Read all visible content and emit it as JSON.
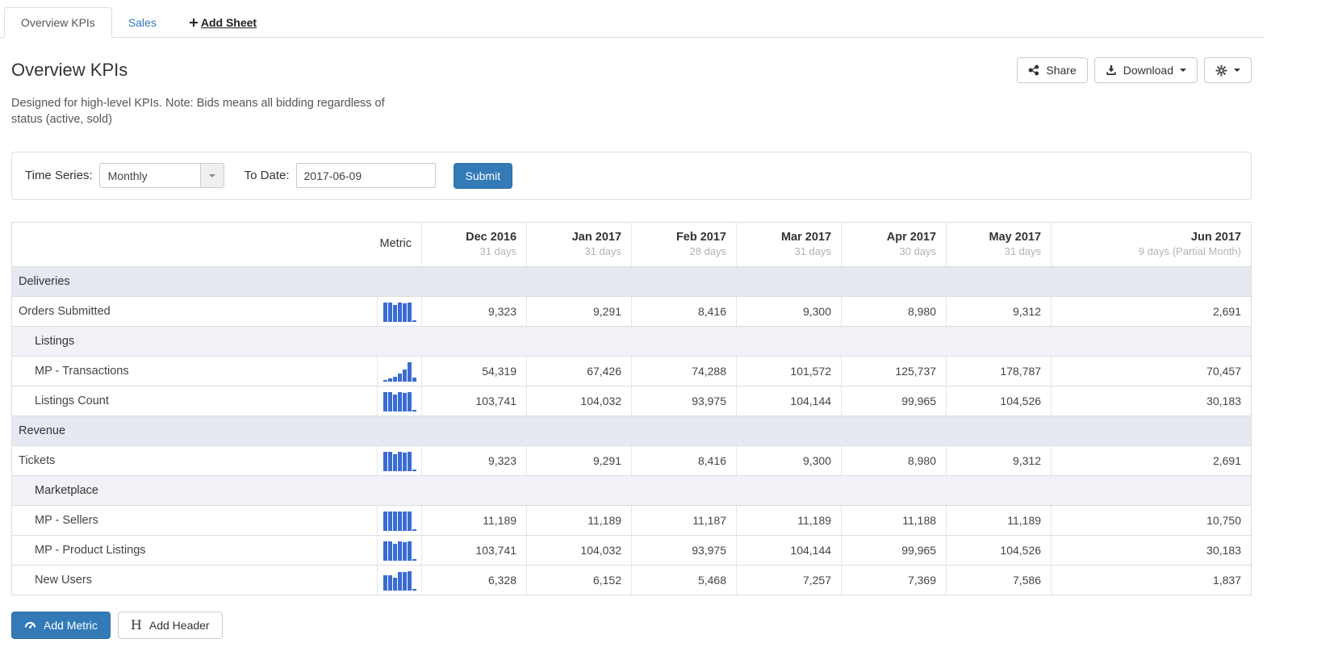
{
  "tabs": [
    {
      "label": "Overview KPIs",
      "active": true
    },
    {
      "label": "Sales",
      "active": false
    },
    {
      "label": "Add Sheet",
      "active": false
    }
  ],
  "header": {
    "title": "Overview KPIs",
    "description": "Designed for high-level KPIs. Note: Bids means all bidding regardless of status (active, sold)",
    "buttons": {
      "share": "Share",
      "download": "Download"
    }
  },
  "filters": {
    "time_series_label": "Time Series:",
    "time_series_value": "Monthly",
    "to_date_label": "To Date:",
    "to_date_value": "2017-06-09",
    "submit_label": "Submit"
  },
  "table": {
    "metric_header": "Metric",
    "columns": [
      {
        "label": "Dec 2016",
        "sub": "31 days"
      },
      {
        "label": "Jan 2017",
        "sub": "31 days"
      },
      {
        "label": "Feb 2017",
        "sub": "28 days"
      },
      {
        "label": "Mar 2017",
        "sub": "31 days"
      },
      {
        "label": "Apr 2017",
        "sub": "30 days"
      },
      {
        "label": "May 2017",
        "sub": "31 days"
      },
      {
        "label": "Jun 2017",
        "sub": "9 days (Partial Month)"
      }
    ],
    "rows": [
      {
        "type": "group",
        "label": "Deliveries",
        "indent": 0
      },
      {
        "type": "metric",
        "label": "Orders Submitted",
        "indent": 0,
        "values": [
          9323,
          9291,
          8416,
          9300,
          8980,
          9312,
          2691
        ]
      },
      {
        "type": "group",
        "label": "Listings",
        "indent": 1
      },
      {
        "type": "metric",
        "label": "MP - Transactions",
        "indent": 1,
        "values": [
          54319,
          67426,
          74288,
          101572,
          125737,
          178787,
          70457
        ]
      },
      {
        "type": "metric",
        "label": "Listings Count",
        "indent": 1,
        "values": [
          103741,
          104032,
          93975,
          104144,
          99965,
          104526,
          30183
        ]
      },
      {
        "type": "group",
        "label": "Revenue",
        "indent": 0
      },
      {
        "type": "metric",
        "label": "Tickets",
        "indent": 0,
        "values": [
          9323,
          9291,
          8416,
          9300,
          8980,
          9312,
          2691
        ]
      },
      {
        "type": "group",
        "label": "Marketplace",
        "indent": 1
      },
      {
        "type": "metric",
        "label": "MP - Sellers",
        "indent": 1,
        "values": [
          11189,
          11189,
          11187,
          11189,
          11188,
          11189,
          10750
        ]
      },
      {
        "type": "metric",
        "label": "MP - Product Listings",
        "indent": 1,
        "values": [
          103741,
          104032,
          93975,
          104144,
          99965,
          104526,
          30183
        ]
      },
      {
        "type": "metric",
        "label": "New Users",
        "indent": 1,
        "values": [
          6328,
          6152,
          5468,
          7257,
          7369,
          7586,
          1837
        ]
      }
    ]
  },
  "footer": {
    "add_metric_label": "Add Metric",
    "add_header_label": "Add Header",
    "add_header_glyph": "H"
  },
  "icons": {
    "tab_add": "plus-icon",
    "share": "share-icon",
    "download": "download-icon",
    "settings": "gear-icon",
    "carets": "caret-down-icon",
    "select_arrow": "caret-down-icon",
    "add_metric": "gauge-icon",
    "add_header": "heading-icon",
    "sparklines": "mini-bar-chart"
  },
  "colors": {
    "accent_blue": "#337ab7",
    "sparkline_blue": "#3b6cd3",
    "section_header_bg": "#e6e8f2",
    "subsection_header_bg": "#f0f2f8"
  }
}
